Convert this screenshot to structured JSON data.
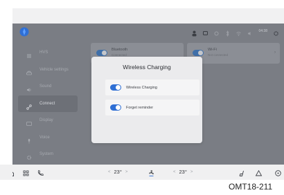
{
  "status": {
    "clock": "04:38",
    "icons": [
      "profile-icon",
      "chat-icon",
      "signal-icon",
      "bluetooth-icon",
      "wifi-icon",
      "sound-icon"
    ]
  },
  "sidebar": {
    "items": [
      {
        "label": "HVS",
        "icon": "home-icon"
      },
      {
        "label": "Vehicle settings",
        "icon": "car-icon"
      },
      {
        "label": "Sound",
        "icon": "speaker-icon"
      },
      {
        "label": "Connect",
        "icon": "connect-icon"
      },
      {
        "label": "Display",
        "icon": "display-icon"
      },
      {
        "label": "Voice",
        "icon": "microphone-icon"
      },
      {
        "label": "System",
        "icon": "gear-icon"
      }
    ]
  },
  "tiles": [
    {
      "title": "Bluetooth",
      "subtitle": "Connected"
    },
    {
      "title": "Wi-Fi",
      "subtitle": "Not connected"
    }
  ],
  "modal": {
    "title": "Wireless Charging",
    "rows": [
      {
        "label": "Wireless Charging",
        "on": true
      },
      {
        "label": "Forget reminder",
        "on": true
      }
    ]
  },
  "climate": {
    "left_temp": "23°",
    "right_temp": "23°",
    "left_down": "<",
    "left_up": ">",
    "right_down": "<",
    "right_up": ">"
  },
  "reference_code": "OMT18-211"
}
